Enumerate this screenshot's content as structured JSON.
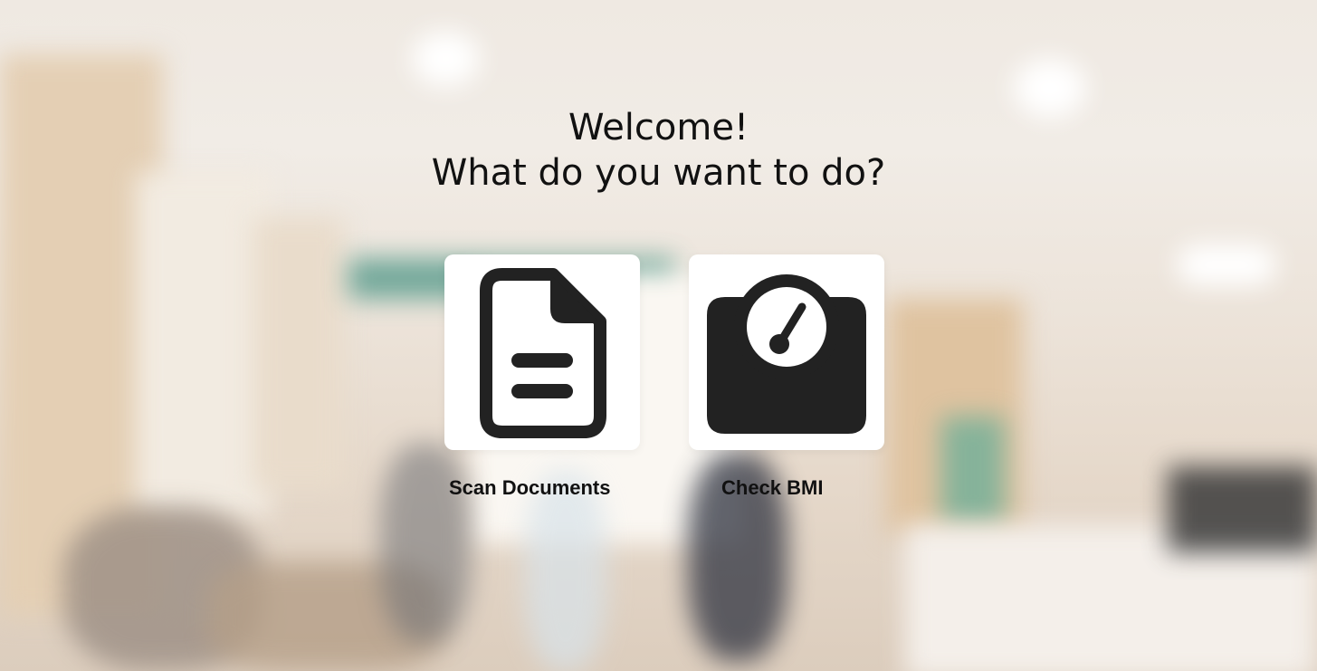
{
  "welcome": {
    "line1": "Welcome!",
    "line2": "What do you want to do?"
  },
  "options": [
    {
      "label": "Scan Documents",
      "icon": "document-icon"
    },
    {
      "label": "Check BMI",
      "icon": "bmi-scale-icon"
    }
  ],
  "colors": {
    "icon": "#222222",
    "tile": "#ffffff",
    "text": "#111111"
  }
}
